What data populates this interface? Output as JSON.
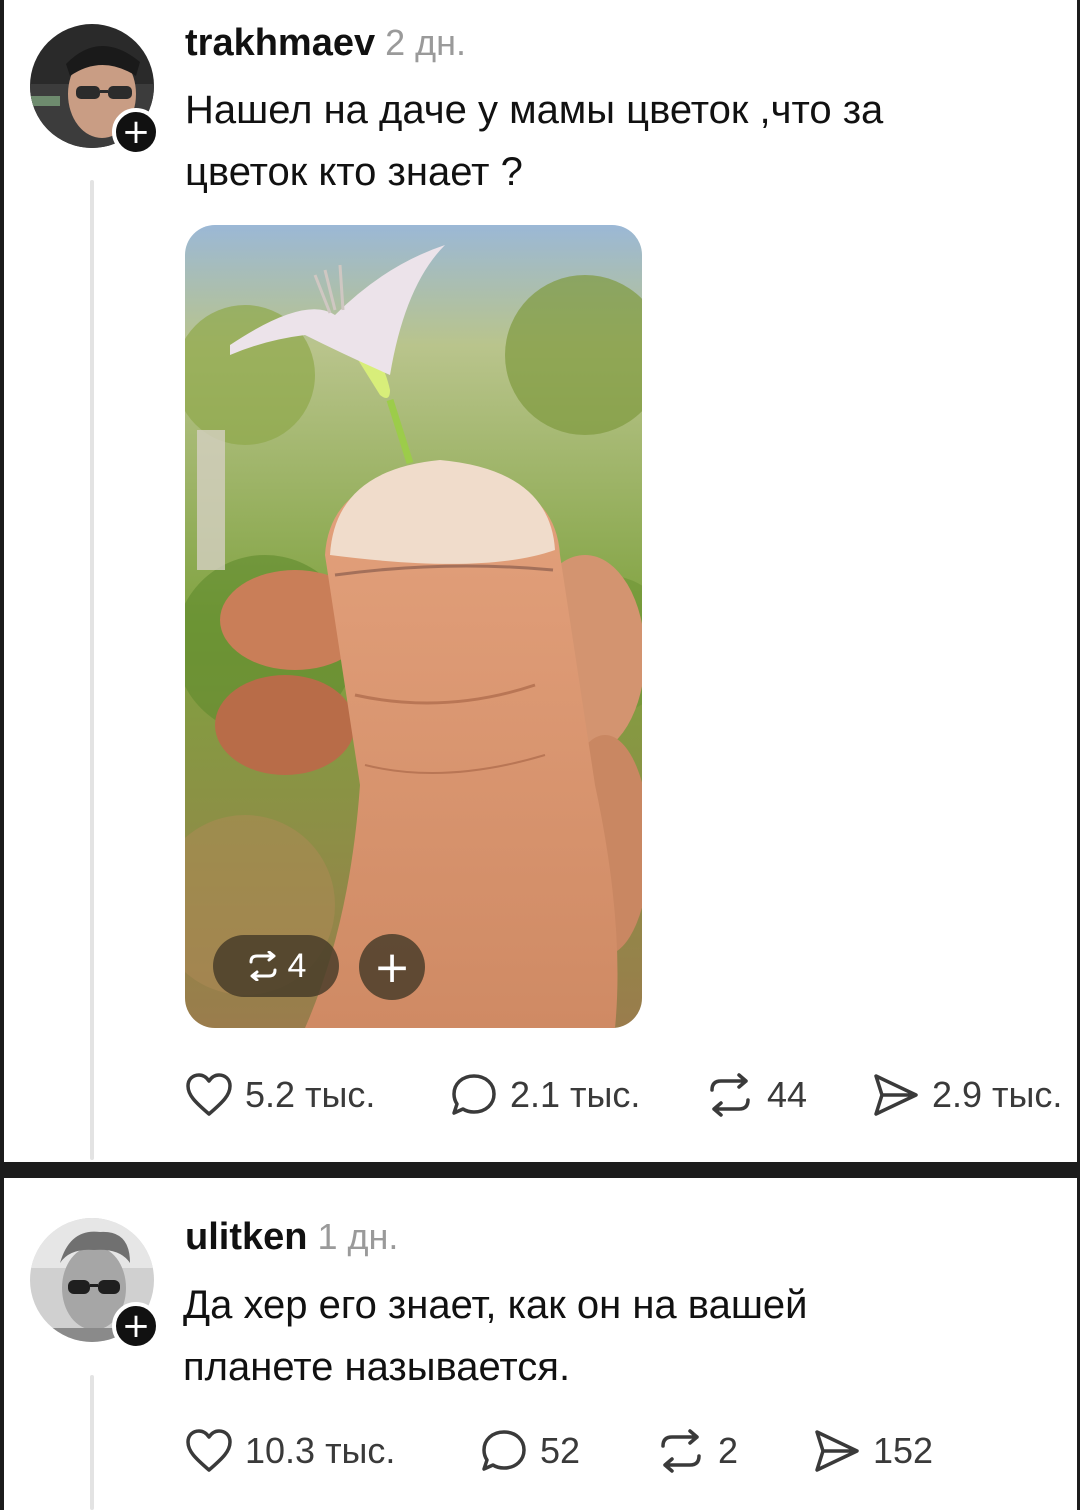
{
  "post1": {
    "username": "trakhmaev",
    "time": "2 дн.",
    "text_line1": "Нашел на даче у мамы цветок ,что за",
    "text_line2": "цветок кто знает ?",
    "media": {
      "repost_count": "4",
      "add_label": "+"
    },
    "stats": {
      "likes": "5.2 тыс.",
      "replies": "2.1 тыс.",
      "reposts": "44",
      "shares": "2.9 тыс."
    },
    "follow_label": "+"
  },
  "post2": {
    "username": "ulitken",
    "time": "1 дн.",
    "text_line1": "Да хер его знает, как он на вашей",
    "text_line2": "планете называется.",
    "stats": {
      "likes": "10.3 тыс.",
      "replies": "52",
      "reposts": "2",
      "shares": "152"
    },
    "follow_label": "+"
  },
  "icons": [
    "heart-icon",
    "comment-icon",
    "repost-icon",
    "share-icon"
  ]
}
